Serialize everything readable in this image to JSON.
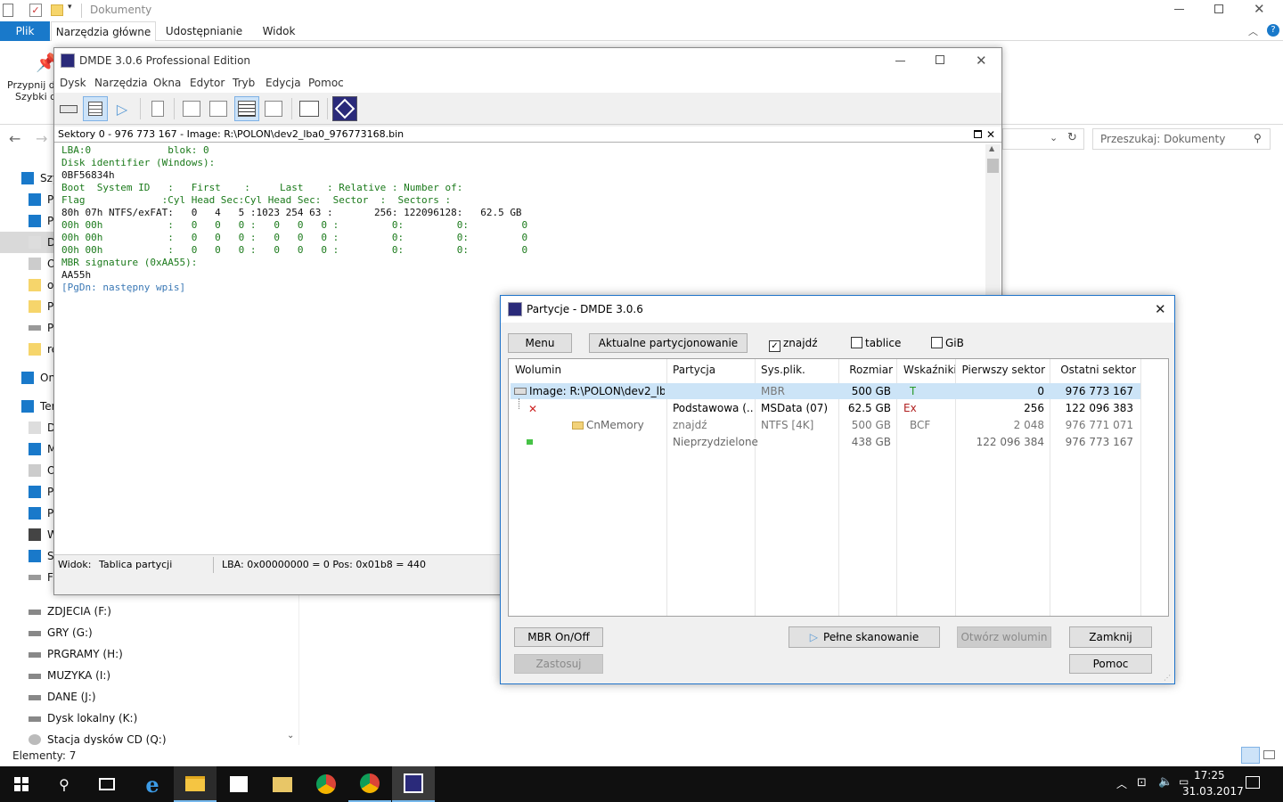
{
  "explorer": {
    "title": "Dokumenty",
    "tabs": {
      "file": "Plik",
      "home": "Narzędzia główne",
      "share": "Udostępnianie",
      "view": "Widok"
    },
    "ribbon_pin_label_1": "Przypnij d",
    "ribbon_pin_label_2": "Szybki d",
    "search_placeholder": "Przeszukaj: Dokumenty",
    "tree_top": [
      {
        "label": "Szy",
        "icon": "star-icon"
      },
      {
        "label": "P",
        "icon": "desktop-icon"
      },
      {
        "label": "P",
        "icon": "download-icon"
      },
      {
        "label": "D",
        "icon": "document-icon"
      },
      {
        "label": "O",
        "icon": "picture-icon"
      },
      {
        "label": "o",
        "icon": "folder-icon"
      },
      {
        "label": "P",
        "icon": "folder-icon"
      },
      {
        "label": "P",
        "icon": "drive-icon"
      },
      {
        "label": "re",
        "icon": "folder-icon"
      },
      {
        "label": "On",
        "icon": "cloud-icon"
      },
      {
        "label": "Ter",
        "icon": "computer-icon"
      },
      {
        "label": "D",
        "icon": "document-icon"
      },
      {
        "label": "M",
        "icon": "music-icon"
      },
      {
        "label": "O",
        "icon": "picture-icon"
      },
      {
        "label": "P",
        "icon": "download-icon"
      },
      {
        "label": "P",
        "icon": "desktop-icon"
      },
      {
        "label": "W",
        "icon": "video-icon"
      },
      {
        "label": "S",
        "icon": "system-icon"
      },
      {
        "label": "F",
        "icon": "drive-icon"
      }
    ],
    "drives": [
      "ZDJECIA (F:)",
      "GRY (G:)",
      "PRGRAMY (H:)",
      "MUZYKA (I:)",
      "DANE (J:)",
      "Dysk lokalny (K:)",
      "Stacja dysków CD (Q:)"
    ],
    "status": "Elementy: 7"
  },
  "dmde": {
    "title": "DMDE 3.0.6 Professional Edition",
    "menu": [
      "Dysk",
      "Narzędzia",
      "Okna",
      "Edytor",
      "Tryb",
      "Edycja",
      "Pomoc"
    ],
    "sector_header": "Sektory 0 - 976 773 167 - Image: R:\\POLON\\dev2_lba0_976773168.bin",
    "hex_lines": [
      "LBA:0             blok: 0",
      "Disk identifier (Windows):",
      "0BF56834h",
      "Boot  System ID   :   First    :     Last    : Relative : Number of:",
      "Flag             :Cyl Head Sec:Cyl Head Sec:  Sector  :  Sectors :",
      "80h 07h NTFS/exFAT:   0   4   5 :1023 254 63 :       256: 122096128:   62.5 GB",
      "00h 00h           :   0   0   0 :   0   0   0 :         0:         0:         0",
      "00h 00h           :   0   0   0 :   0   0   0 :         0:         0:         0",
      "00h 00h           :   0   0   0 :   0   0   0 :         0:         0:         0",
      "MBR signature (0xAA55):",
      "AA55h",
      "[PgDn: następny wpis]"
    ],
    "status_view_label": "Widok:",
    "status_view_value": "Tablica partycji",
    "status_lba": "LBA: 0x00000000 = 0  Pos: 0x01b8 = 440"
  },
  "partitions": {
    "title": "Partycje - DMDE 3.0.6",
    "menu_button": "Menu",
    "current_button": "Aktualne partycjonowanie",
    "cb_find": "znajdź",
    "cb_tables": "tablice",
    "cb_gib": "GiB",
    "columns": [
      "Wolumin",
      "Partycja",
      "Sys.plik.",
      "Rozmiar",
      "Wskaźniki",
      "Pierwszy sektor",
      "Ostatni sektor"
    ],
    "rows": [
      {
        "vol": "Image: R:\\POLON\\dev2_lb...",
        "part": "",
        "fs": "MBR",
        "size": "500 GB",
        "flags": "T",
        "first": "0",
        "last": "976 773 167"
      },
      {
        "vol": "",
        "part": "Podstawowa (...",
        "fs": "MSData (07)",
        "size": "62.5 GB",
        "flags": "Ex",
        "first": "256",
        "last": "122 096 383"
      },
      {
        "vol": "CnMemory",
        "part": "znajdź",
        "fs": "NTFS [4K]",
        "size": "500 GB",
        "flags": "BCF",
        "first": "2 048",
        "last": "976 771 071"
      },
      {
        "vol": "",
        "part": "Nieprzydzielone",
        "fs": "",
        "size": "438 GB",
        "flags": "",
        "first": "122 096 384",
        "last": "976 773 167"
      }
    ],
    "mbr_button": "MBR On/Off",
    "apply_button": "Zastosuj",
    "full_scan_button": "Pełne skanowanie",
    "open_volume_button": "Otwórz wolumin",
    "close_button": "Zamknij",
    "help_button": "Pomoc"
  },
  "taskbar": {
    "time": "17:25",
    "date": "31.03.2017"
  }
}
